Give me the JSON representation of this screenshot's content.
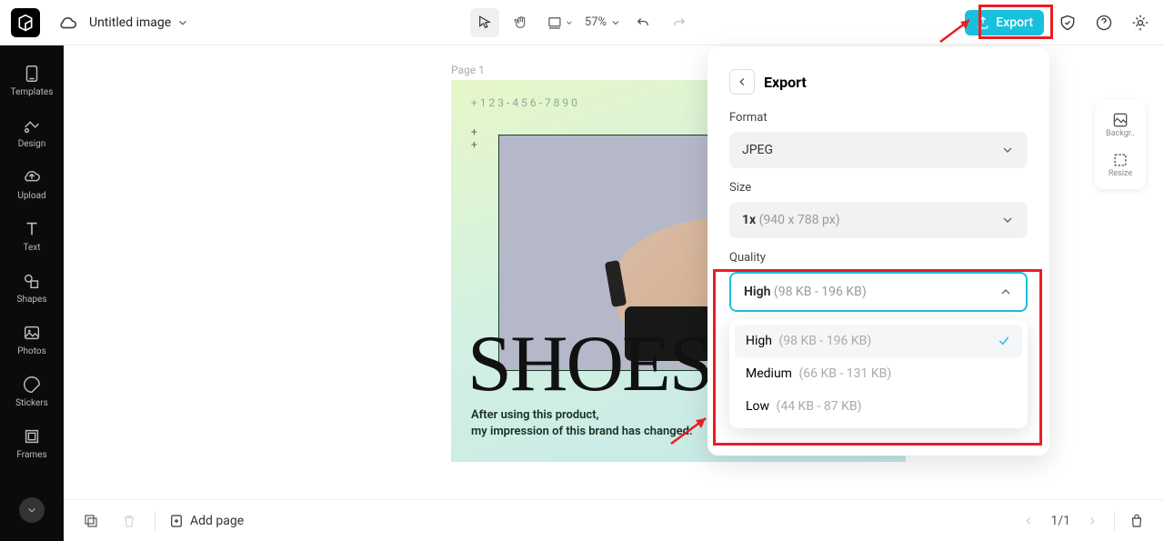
{
  "header": {
    "doc_title": "Untitled image",
    "zoom": "57%",
    "export_label": "Export"
  },
  "sidebar": {
    "items": [
      {
        "label": "Templates"
      },
      {
        "label": "Design"
      },
      {
        "label": "Upload"
      },
      {
        "label": "Text"
      },
      {
        "label": "Shapes"
      },
      {
        "label": "Photos"
      },
      {
        "label": "Stickers"
      },
      {
        "label": "Frames"
      }
    ]
  },
  "right_tools": {
    "bg_label": "Backgr..",
    "resize_label": "Resize"
  },
  "canvas": {
    "page_label": "Page 1",
    "phone": "+123-456-7890",
    "headline": "SHOES",
    "caption_line1": "After using this product,",
    "caption_line2": "my impression of this brand has changed."
  },
  "export_panel": {
    "title": "Export",
    "format_label": "Format",
    "format_value": "JPEG",
    "size_label": "Size",
    "size_prefix": "1x",
    "size_dim": "(940 x 788 px)",
    "quality_label": "Quality",
    "quality_selected_name": "High",
    "quality_selected_size": "(98 KB - 196 KB)",
    "quality_options": [
      {
        "name": "High",
        "size": "(98 KB - 196 KB)",
        "selected": true
      },
      {
        "name": "Medium",
        "size": "(66 KB - 131 KB)",
        "selected": false
      },
      {
        "name": "Low",
        "size": "(44 KB - 87 KB)",
        "selected": false
      }
    ]
  },
  "bottom": {
    "add_page": "Add page",
    "page_indicator": "1/1"
  }
}
